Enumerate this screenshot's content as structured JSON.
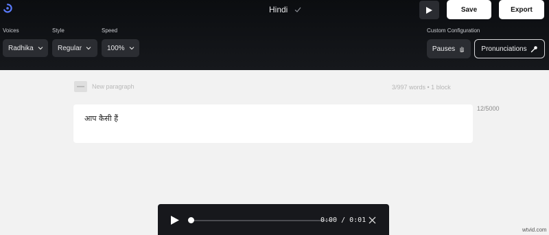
{
  "header": {
    "title": "Hindi",
    "save_label": "Save",
    "export_label": "Export"
  },
  "controls": {
    "voices_label": "Voices",
    "voice_value": "Radhika",
    "style_label": "Style",
    "style_value": "Regular",
    "speed_label": "Speed",
    "speed_value": "100%",
    "custom_config_label": "Custom Configuration",
    "pauses_label": "Pauses",
    "pronunciations_label": "Pronunciations"
  },
  "editor": {
    "paragraph_placeholder": "New paragraph",
    "stats": "3/997 words  •  1 block",
    "text": "आप कैसी हैं",
    "char_count": "12/5000"
  },
  "player": {
    "time": "0:00 / 0:01",
    "progress": 0
  },
  "watermark": "wtvid.com",
  "colors": {
    "topbar": "#111317",
    "accent_logo": "#5b7cff",
    "page_bg": "#f2f2f2"
  }
}
